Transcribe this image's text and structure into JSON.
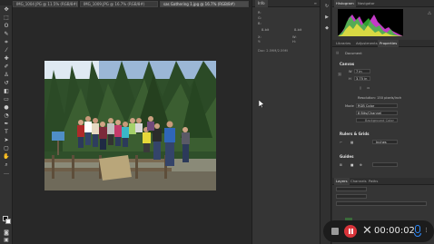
{
  "tabs": [
    {
      "label": "IMG_1004 JPG @ 11.5% (RGB/8#)"
    },
    {
      "label": "IMG_1009.JPG @ 16.7% (RGB/8#)"
    },
    {
      "label": "sas Gathering 1.jpg @ 16.7% (RGB/8#)"
    }
  ],
  "info_panel": {
    "tab": "Info",
    "doc_size": "Doc: 2.59M/2.59M",
    "rgb_values": [
      "R:",
      "G:",
      "B:"
    ],
    "xy_labels": [
      "X:",
      "Y:"
    ],
    "bit_depth": [
      "8-bit",
      "8-bit"
    ],
    "wh_labels": [
      "W:",
      "H:"
    ]
  },
  "navigator": {
    "tabs": [
      "Histogram",
      "Navigator"
    ]
  },
  "properties": {
    "tabs": [
      "Libraries",
      "Adjustments",
      "Properties"
    ],
    "doc_label": "Document",
    "canvas_title": "Canvas",
    "w_label": "W",
    "w_value": "7 in",
    "h_label": "H",
    "h_value": "3.75 in",
    "resolution_label": "Resolution: 150 pixels/inch",
    "mode_label": "Mode",
    "mode_value": "RGB Color",
    "depth_value": "8 Bits/Channel",
    "fill_value": "Background Color",
    "rulers_title": "Rulers & Grids",
    "rulers_unit": "Inches",
    "guides_title": "Guides"
  },
  "layers": {
    "tabs": [
      "Layers",
      "Channels",
      "Paths"
    ]
  },
  "recording": {
    "time": "00:00:02"
  },
  "colors": {
    "record_red": "#d8343a",
    "mic_blue": "#2f8cff"
  }
}
